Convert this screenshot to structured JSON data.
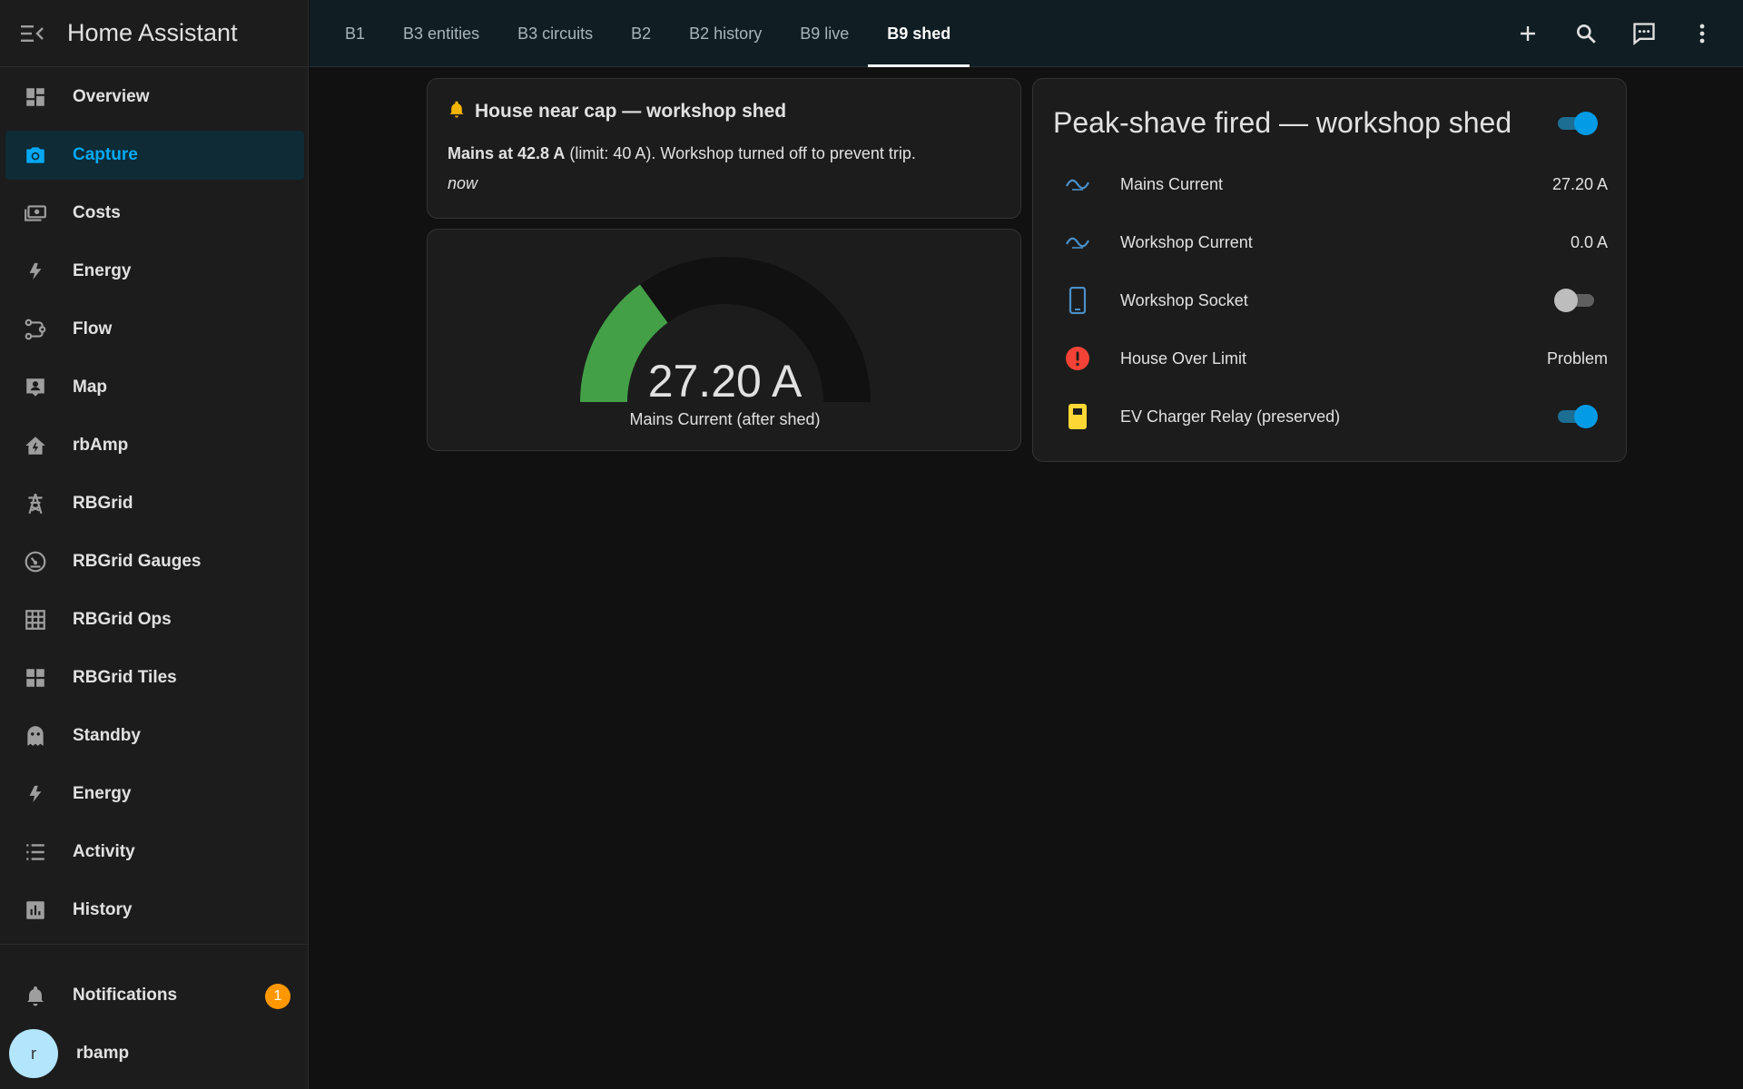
{
  "app": {
    "title": "Home Assistant"
  },
  "sidebar": {
    "items": [
      {
        "label": "Overview",
        "icon": "view-dashboard-icon"
      },
      {
        "label": "Capture",
        "icon": "camera-icon",
        "active": true
      },
      {
        "label": "Costs",
        "icon": "cash-icon"
      },
      {
        "label": "Energy",
        "icon": "lightning-bolt-icon"
      },
      {
        "label": "Flow",
        "icon": "flow-icon"
      },
      {
        "label": "Map",
        "icon": "account-box-icon"
      },
      {
        "label": "rbAmp",
        "icon": "home-lightning-icon"
      },
      {
        "label": "RBGrid",
        "icon": "transmission-tower-icon"
      },
      {
        "label": "RBGrid Gauges",
        "icon": "gauge-icon"
      },
      {
        "label": "RBGrid Ops",
        "icon": "grid-icon"
      },
      {
        "label": "RBGrid Tiles",
        "icon": "tiles-icon"
      },
      {
        "label": "Standby",
        "icon": "ghost-icon"
      },
      {
        "label": "Energy",
        "icon": "lightning-bolt-icon"
      },
      {
        "label": "Activity",
        "icon": "format-list-icon"
      },
      {
        "label": "History",
        "icon": "chart-box-icon"
      }
    ],
    "notifications": {
      "label": "Notifications",
      "count": "1"
    },
    "user": {
      "name": "rbamp",
      "initial": "r"
    }
  },
  "topbar": {
    "tabs": [
      {
        "label": "B1"
      },
      {
        "label": "B3 entities"
      },
      {
        "label": "B3 circuits"
      },
      {
        "label": "B2"
      },
      {
        "label": "B2 history"
      },
      {
        "label": "B9 live"
      },
      {
        "label": "B9 shed",
        "active": true
      }
    ],
    "actions": [
      "plus-icon",
      "search-icon",
      "assist-chat-icon",
      "dots-vertical-icon"
    ]
  },
  "notice": {
    "title": "House near cap — workshop shed",
    "body_bold": "Mains at 42.8 A",
    "body_rest": " (limit: 40 A). Workshop turned off to prevent trip.",
    "time": "now"
  },
  "gauge": {
    "value": "27.20 A",
    "label": "Mains Current (after shed)",
    "fraction": 0.3,
    "color": "#43a047",
    "track_color": "#111111"
  },
  "entities": {
    "title": "Peak-shave fired — workshop shed",
    "header_toggle": true,
    "rows": [
      {
        "name": "Mains Current",
        "value": "27.20 A",
        "icon": "current-ac-icon"
      },
      {
        "name": "Workshop Current",
        "value": "0.0 A",
        "icon": "current-ac-icon"
      },
      {
        "name": "Workshop Socket",
        "toggle": false,
        "icon": "cellphone-icon"
      },
      {
        "name": "House Over Limit",
        "value": "Problem",
        "icon": "alert-circle-icon"
      },
      {
        "name": "EV Charger Relay (preserved)",
        "toggle": true,
        "icon": "ev-station-icon"
      }
    ]
  },
  "colors": {
    "accent": "#03a9f4",
    "badge": "#ff9800",
    "problem": "#f44336",
    "ev": "#fdd835"
  }
}
